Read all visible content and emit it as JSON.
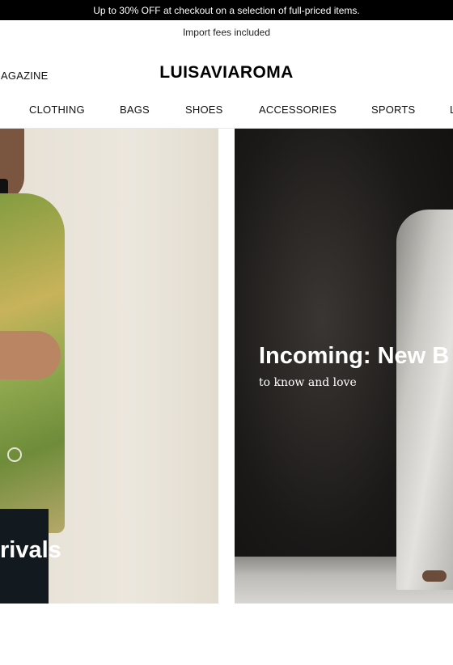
{
  "promo_bar": {
    "text": "Up to 30% OFF at checkout on a selection of full-priced items."
  },
  "header": {
    "fees_note": "Import fees included",
    "magazine_link": "MAGAZINE",
    "logo": "LUISAVIAROMA"
  },
  "nav": {
    "items": [
      {
        "label": "CLOTHING"
      },
      {
        "label": "BAGS"
      },
      {
        "label": "SHOES"
      },
      {
        "label": "ACCESSORIES"
      },
      {
        "label": "SPORTS"
      },
      {
        "label": "L"
      }
    ]
  },
  "cards": [
    {
      "title": "rivals",
      "subtitle": ""
    },
    {
      "title": "Incoming: New B",
      "subtitle": "to know and love"
    }
  ]
}
